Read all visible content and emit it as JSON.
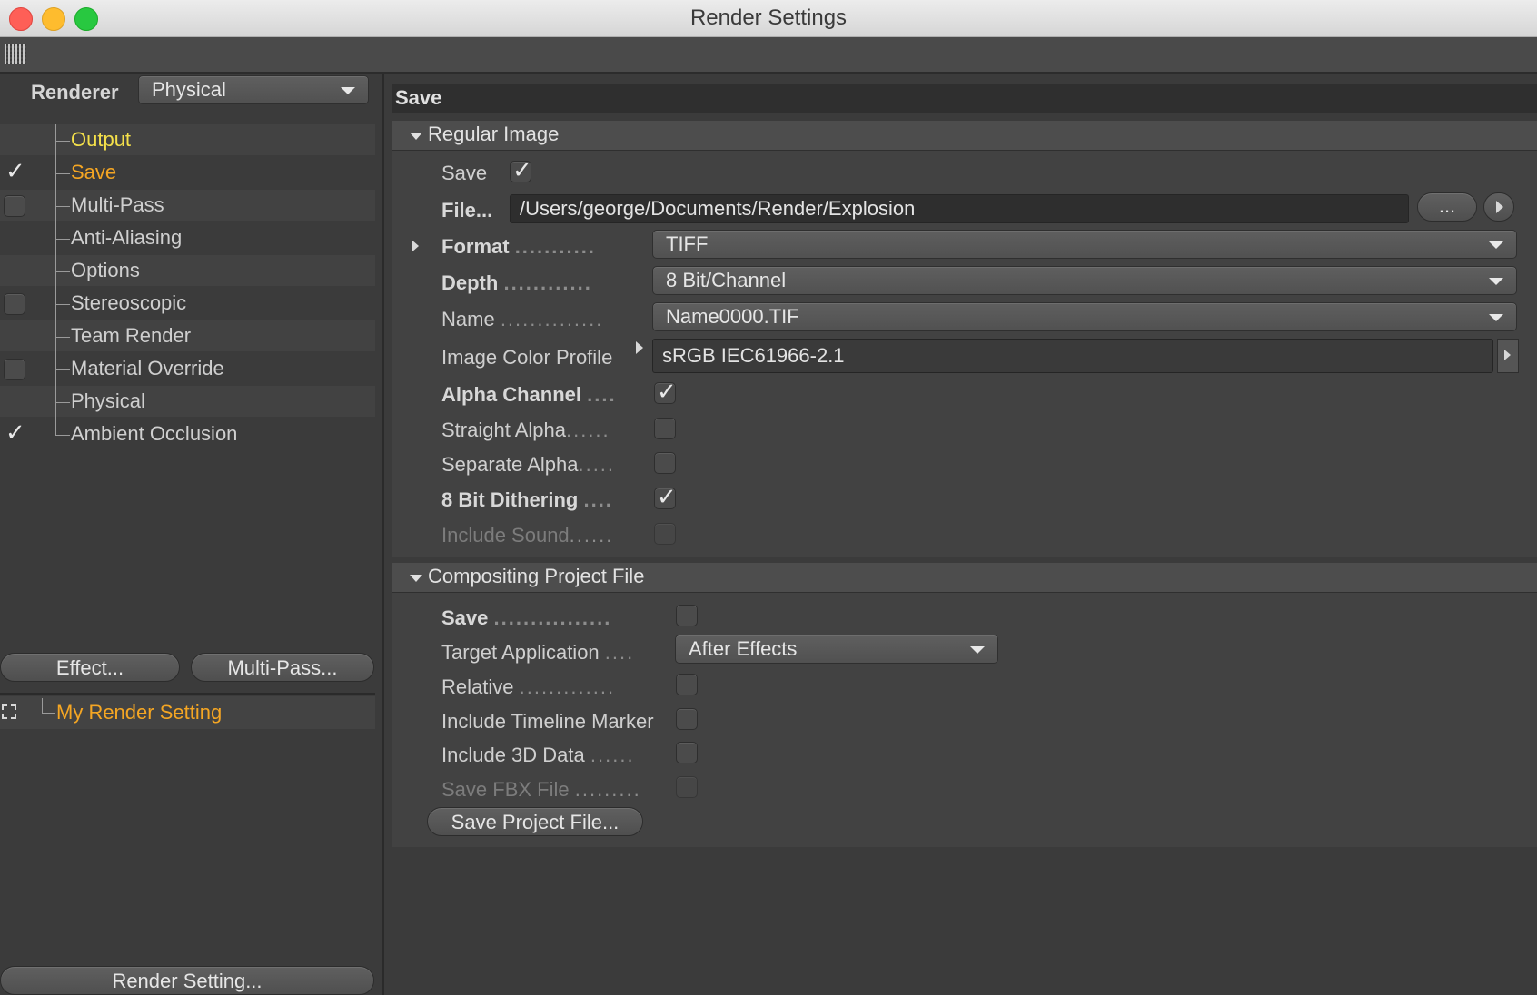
{
  "window": {
    "title": "Render Settings"
  },
  "left": {
    "renderer_label": "Renderer",
    "renderer_value": "Physical",
    "tree": [
      {
        "label": "Output",
        "color": "#f4e04a",
        "check": "none"
      },
      {
        "label": "Save",
        "color": "#f5a623",
        "check": "on"
      },
      {
        "label": "Multi-Pass",
        "color": "#cfcfcf",
        "check": "off"
      },
      {
        "label": "Anti-Aliasing",
        "color": "#cfcfcf",
        "check": "none"
      },
      {
        "label": "Options",
        "color": "#cfcfcf",
        "check": "none"
      },
      {
        "label": "Stereoscopic",
        "color": "#cfcfcf",
        "check": "off"
      },
      {
        "label": "Team Render",
        "color": "#cfcfcf",
        "check": "none"
      },
      {
        "label": "Material Override",
        "color": "#cfcfcf",
        "check": "off"
      },
      {
        "label": "Physical",
        "color": "#cfcfcf",
        "check": "none"
      },
      {
        "label": "Ambient Occlusion",
        "color": "#cfcfcf",
        "check": "on"
      }
    ],
    "effect_button": "Effect...",
    "multipass_button": "Multi-Pass...",
    "setting_name": "My Render Setting",
    "render_setting_button": "Render Setting..."
  },
  "right": {
    "header": "Save",
    "regular": {
      "title": "Regular Image",
      "save_label": "Save",
      "file_label": "File...",
      "file_path": "/Users/george/Documents/Render/Explosion",
      "browse_label": "...",
      "format_label": "Format",
      "format_value": "TIFF",
      "depth_label": "Depth",
      "depth_value": "8 Bit/Channel",
      "name_label": "Name",
      "name_value": "Name0000.TIF",
      "profile_label": "Image Color Profile",
      "profile_value": "sRGB IEC61966-2.1",
      "alpha_label": "Alpha Channel",
      "straight_label": "Straight Alpha",
      "separate_label": "Separate Alpha",
      "dither_label": "8 Bit Dithering",
      "sound_label": "Include Sound",
      "dots_long": "...........",
      "dots_med": "............",
      "dots_name": "..............",
      "dots_short": "....",
      "dots_6": "......",
      "dots_5": "....."
    },
    "compositing": {
      "title": "Compositing Project File",
      "save_label": "Save",
      "target_label": "Target Application",
      "target_value": "After Effects",
      "relative_label": "Relative",
      "timeline_label": "Include Timeline Marker",
      "data3d_label": "Include 3D Data",
      "fbx_label": "Save FBX File",
      "project_button": "Save Project File...",
      "dots_save": "................",
      "dots_target": "....",
      "dots_relative": ".............",
      "dots_3d": "......",
      "dots_fbx": "........."
    }
  },
  "colors": {
    "accent_orange": "#f5a623",
    "accent_yellow": "#f4e04a"
  }
}
